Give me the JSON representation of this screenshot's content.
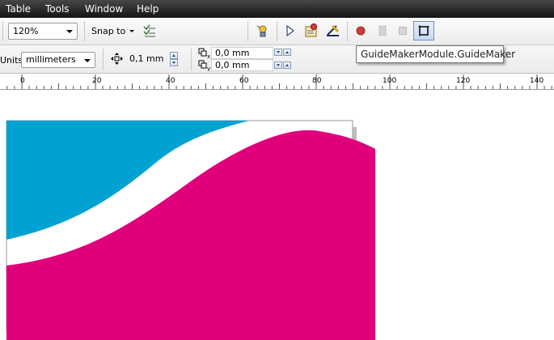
{
  "menu": {
    "items": [
      {
        "label": "Table"
      },
      {
        "label": "Tools"
      },
      {
        "label": "Window"
      },
      {
        "label": "Help"
      }
    ]
  },
  "toolbar": {
    "zoom_value": "120%",
    "snap_label": "Snap to",
    "icons": [
      "snap-options-icon",
      "macro-icon",
      "play-icon",
      "record-macro-icon",
      "guide-edit-icon",
      "record-icon",
      "pause-icon",
      "stop-icon",
      "guidemaker-icon"
    ]
  },
  "property_bar": {
    "units_label": "Units:",
    "units_value": "millimeters",
    "nudge_value": "0,1 mm",
    "dup_x_value": "0,0 mm",
    "dup_y_value": "0,0 mm"
  },
  "tooltip": {
    "text": "GuideMakerModule.GuideMaker"
  },
  "ruler": {
    "labels": [
      "0",
      "20",
      "40",
      "60",
      "80",
      "100",
      "120",
      "140"
    ]
  },
  "colors": {
    "cyan": "#00a2d2",
    "magenta": "#e0007c",
    "menubar": "#262626"
  }
}
